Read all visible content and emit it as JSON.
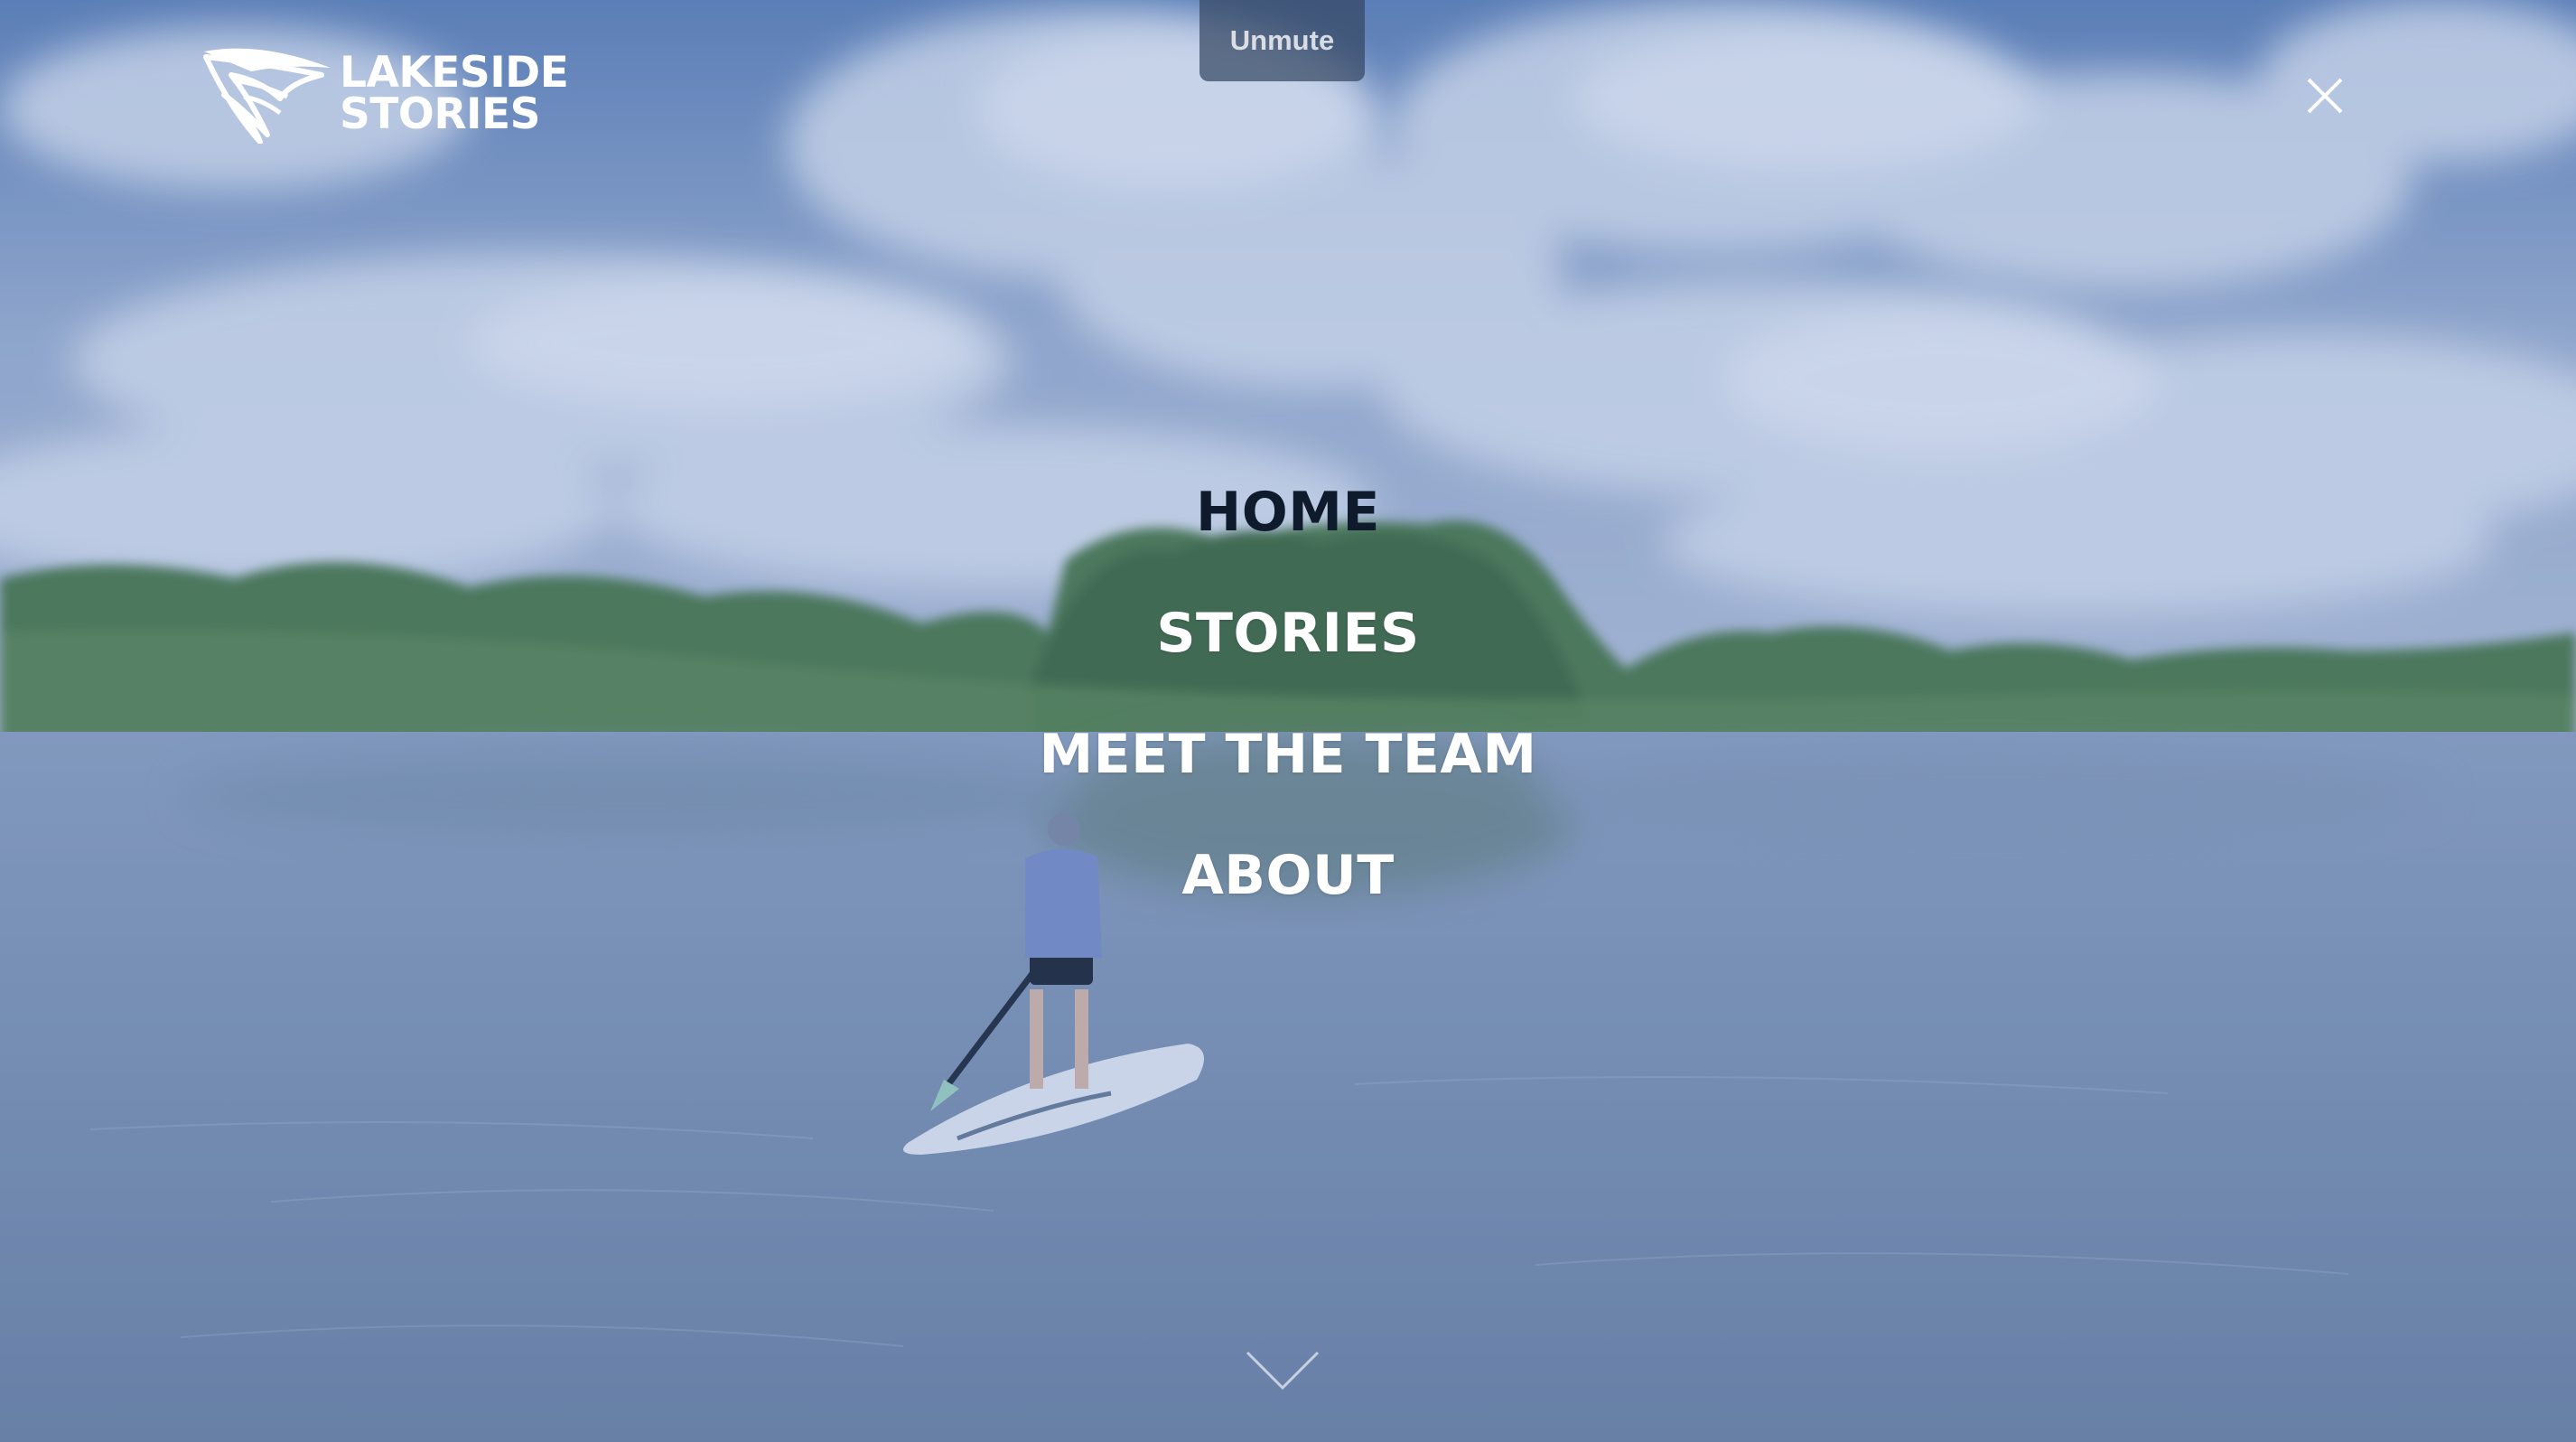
{
  "site": {
    "logo_line1": "LAKESIDE",
    "logo_line2": "STORIES"
  },
  "video": {
    "unmute_label": "Unmute"
  },
  "menu": {
    "items": [
      {
        "label": "HOME",
        "active": true
      },
      {
        "label": "STORIES",
        "active": false
      },
      {
        "label": "MEET THE TEAM",
        "active": false
      },
      {
        "label": "ABOUT",
        "active": false
      }
    ]
  },
  "icons": {
    "close": "close-icon",
    "scroll": "chevron-down-icon",
    "logo": "wave-logo-icon"
  },
  "colors": {
    "menu_text": "#ffffff",
    "menu_active": "#0f1b2d",
    "overlay": "#466ebe",
    "unmute_bg": "#344662"
  }
}
